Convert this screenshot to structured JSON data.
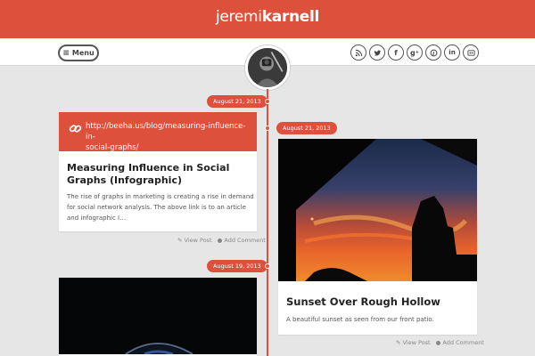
{
  "header": {
    "brand_first": "jeremi",
    "brand_last": "karnell",
    "bg_color": "#dd513c"
  },
  "navbar": {
    "menu_label": "Menu",
    "menu_icon": "hamburger-icon",
    "social_icons": [
      "rss-icon",
      "twitter-icon",
      "facebook-icon",
      "google-plus-icon",
      "pinterest-icon",
      "linkedin-icon",
      "flickr-icon"
    ]
  },
  "timeline": {
    "accent_color": "#dd513c",
    "posts": [
      {
        "date": "August 21, 2013",
        "type": "link",
        "link_icon": "link-chain-icon",
        "link_line1": "http://beeha.us/blog/measuring-influence-in-",
        "link_line2": "social-graphs/",
        "title_line1": "Measuring Influence in Social",
        "title_line2": "Graphs (Infographic)",
        "excerpt_line1": "The rise of graphs in marketing is creating a rise in demand",
        "excerpt_line2": "for social network analysis. The above link is to an article",
        "excerpt_line3": "and infographic I…",
        "view_post": "View Post",
        "add_comment": "Add Comment"
      },
      {
        "date": "August 21, 2013",
        "type": "image",
        "image": "sunset-photo",
        "title": "Sunset Over Rough Hollow",
        "excerpt": "A beautiful sunset as seen from our front patio.",
        "view_post": "View Post",
        "add_comment": "Add Comment"
      },
      {
        "date": "August 19, 2013",
        "type": "image",
        "image": "earth-from-space-photo"
      }
    ]
  }
}
